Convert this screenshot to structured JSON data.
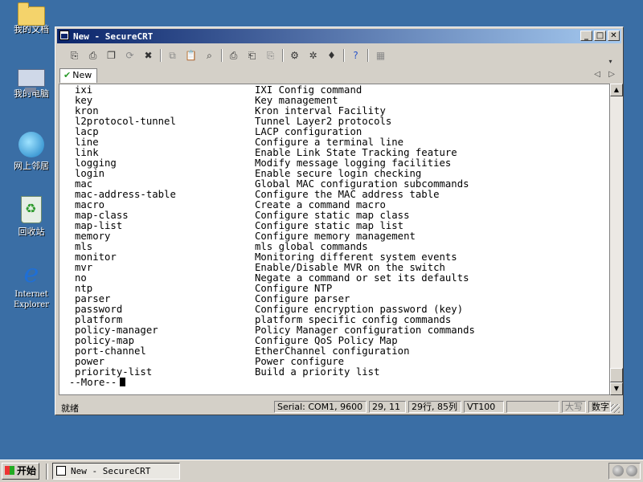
{
  "desktop": {
    "icons": [
      {
        "label": "我的文档",
        "icon": "folder-icon"
      },
      {
        "label": "我的电脑",
        "icon": "computer-icon"
      },
      {
        "label": "网上邻居",
        "icon": "network-icon"
      },
      {
        "label": "回收站",
        "icon": "recycle-bin-icon"
      },
      {
        "label": "Internet Explorer",
        "icon": "internet-explorer-icon"
      }
    ]
  },
  "window": {
    "title": "New - SecureCRT",
    "controls": {
      "minimize": "_",
      "maximize": "□",
      "close": "✕"
    }
  },
  "tab": {
    "label": "New"
  },
  "terminal": {
    "lines": [
      {
        "cmd": "ixi",
        "desc": "IXI Config command"
      },
      {
        "cmd": "key",
        "desc": "Key management"
      },
      {
        "cmd": "kron",
        "desc": "Kron interval Facility"
      },
      {
        "cmd": "l2protocol-tunnel",
        "desc": "Tunnel Layer2 protocols"
      },
      {
        "cmd": "lacp",
        "desc": "LACP configuration"
      },
      {
        "cmd": "line",
        "desc": "Configure a terminal line"
      },
      {
        "cmd": "link",
        "desc": "Enable Link State Tracking feature"
      },
      {
        "cmd": "logging",
        "desc": "Modify message logging facilities"
      },
      {
        "cmd": "login",
        "desc": "Enable secure login checking"
      },
      {
        "cmd": "mac",
        "desc": "Global MAC configuration subcommands"
      },
      {
        "cmd": "mac-address-table",
        "desc": "Configure the MAC address table"
      },
      {
        "cmd": "macro",
        "desc": "Create a command macro"
      },
      {
        "cmd": "map-class",
        "desc": "Configure static map class"
      },
      {
        "cmd": "map-list",
        "desc": "Configure static map list"
      },
      {
        "cmd": "memory",
        "desc": "Configure memory management"
      },
      {
        "cmd": "mls",
        "desc": "mls global commands"
      },
      {
        "cmd": "monitor",
        "desc": "Monitoring different system events"
      },
      {
        "cmd": "mvr",
        "desc": "Enable/Disable MVR on the switch"
      },
      {
        "cmd": "no",
        "desc": "Negate a command or set its defaults"
      },
      {
        "cmd": "ntp",
        "desc": "Configure NTP"
      },
      {
        "cmd": "parser",
        "desc": "Configure parser"
      },
      {
        "cmd": "password",
        "desc": "Configure encryption password (key)"
      },
      {
        "cmd": "platform",
        "desc": "platform specific config commands"
      },
      {
        "cmd": "policy-manager",
        "desc": "Policy Manager configuration commands"
      },
      {
        "cmd": "policy-map",
        "desc": "Configure QoS Policy Map"
      },
      {
        "cmd": "port-channel",
        "desc": "EtherChannel configuration"
      },
      {
        "cmd": "power",
        "desc": "Power configure"
      },
      {
        "cmd": "priority-list",
        "desc": "Build a priority list"
      }
    ],
    "more_prompt": "--More--"
  },
  "status": {
    "ready": "就绪",
    "connection": "Serial: COM1, 9600",
    "cursor": "29, 11",
    "size": "29行, 85列",
    "emulation": "VT100",
    "caps": "大写",
    "num": "数字"
  },
  "taskbar": {
    "start": "开始",
    "task": "New - SecureCRT"
  }
}
